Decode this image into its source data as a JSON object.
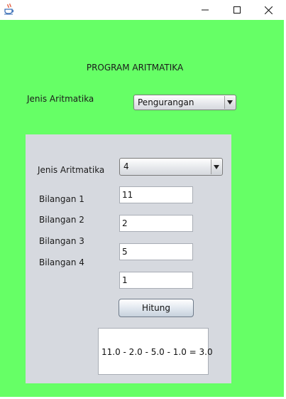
{
  "window": {
    "icon": "java-coffee-cup-icon",
    "controls": [
      "minimize-icon",
      "maximize-icon",
      "close-icon"
    ]
  },
  "header": {
    "title": "PROGRAM ARITMATIKA"
  },
  "top_form": {
    "jenis_label": "Jenis Aritmatika",
    "jenis_selected": "Pengurangan"
  },
  "panel": {
    "jenis_label": "Jenis Aritmatika",
    "count_selected": "4",
    "labels": [
      "Bilangan 1",
      "Bilangan 2",
      "Bilangan 3",
      "Bilangan 4"
    ],
    "values": [
      "11",
      "2",
      "5",
      "1"
    ],
    "button_label": "Hitung",
    "result": "11.0 - 2.0 - 5.0 - 1.0 = 3.0"
  },
  "colors": {
    "background": "#66ff66",
    "panel": "#d6d9df"
  }
}
